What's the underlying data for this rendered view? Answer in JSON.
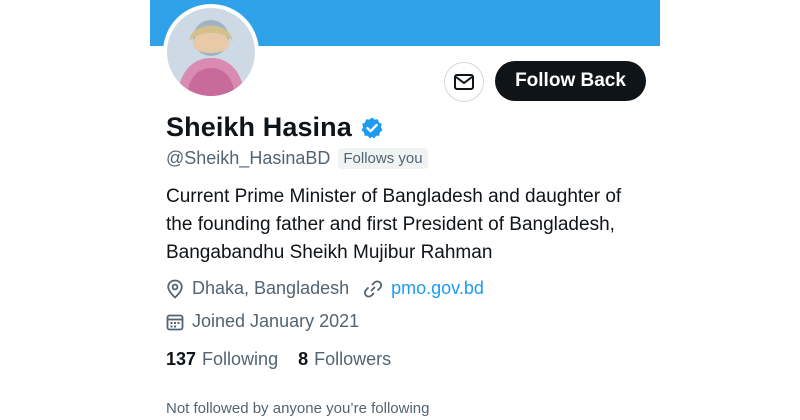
{
  "profile": {
    "name": "Sheikh Hasina",
    "handle": "@Sheikh_HasinaBD",
    "follows_you": "Follows you",
    "verified": true,
    "verified_color": "#1d9bf0",
    "bio_lines": [
      "Current Prime Minister of Bangladesh and daughter of",
      "the founding father and first President of Bangladesh,",
      "Bangabandhu Sheikh Mujibur Rahman"
    ],
    "location": "Dhaka, Bangladesh",
    "website": "pmo.gov.bd",
    "joined": "Joined January 2021",
    "following_count": "137",
    "following_label": "Following",
    "followers_count": "8",
    "followers_label": "Followers",
    "not_followed_note": "Not followed by anyone you’re following"
  },
  "actions": {
    "follow_back_label": "Follow Back",
    "message_icon": "envelope-icon"
  },
  "colors": {
    "banner": "#2ea1e8",
    "button_dark": "#0f1419",
    "link": "#1d9bf0",
    "muted": "#536471"
  },
  "icons": {
    "verified": "verified-badge-icon",
    "location": "location-pin-icon",
    "link": "link-icon",
    "calendar": "calendar-icon"
  }
}
